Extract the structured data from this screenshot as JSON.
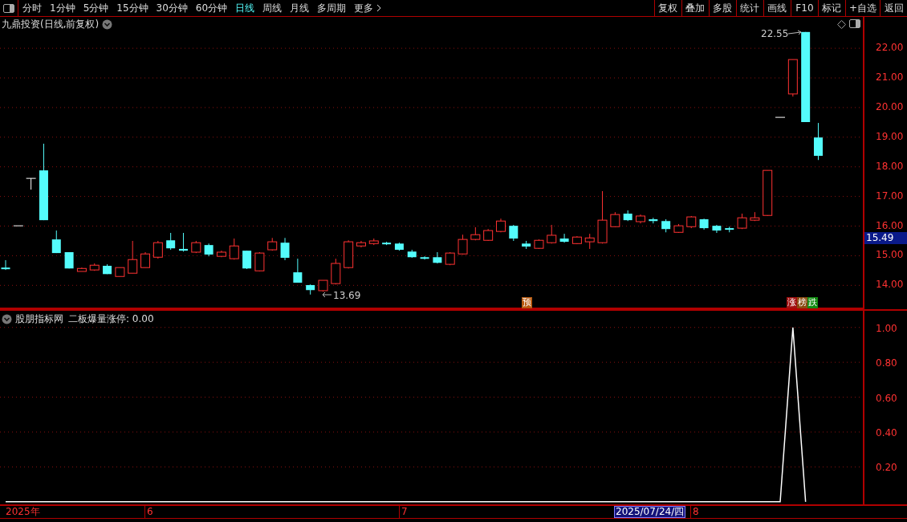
{
  "toolbar": {
    "periods": [
      {
        "label": "分时",
        "selected": false
      },
      {
        "label": "1分钟",
        "selected": false
      },
      {
        "label": "5分钟",
        "selected": false
      },
      {
        "label": "15分钟",
        "selected": false
      },
      {
        "label": "30分钟",
        "selected": false
      },
      {
        "label": "60分钟",
        "selected": false
      },
      {
        "label": "日线",
        "selected": true
      },
      {
        "label": "周线",
        "selected": false
      },
      {
        "label": "月线",
        "selected": false
      },
      {
        "label": "多周期",
        "selected": false
      },
      {
        "label": "更多",
        "selected": false
      }
    ],
    "actions": [
      "复权",
      "叠加",
      "多股",
      "统计",
      "画线",
      "F10",
      "标记",
      "+自选",
      "返回"
    ]
  },
  "main_pane": {
    "title": "九鼎投资(日线,前复权)",
    "high_label": "22.55",
    "low_label": "13.69",
    "current_price": "15.49",
    "markers": [
      {
        "text": "预",
        "color": "#b85a10"
      },
      {
        "text": "涨",
        "color": "#a01010"
      },
      {
        "text": "榜",
        "color": "#8a4a10"
      },
      {
        "text": "跌",
        "color": "#108a10"
      }
    ],
    "chart_data": {
      "type": "candlestick",
      "ylim": [
        13.25,
        23.06
      ],
      "grid": true,
      "yticks": [
        {
          "value": 22,
          "label": "22.00"
        },
        {
          "value": 21,
          "label": "21.00"
        },
        {
          "value": 20,
          "label": "20.00"
        },
        {
          "value": 19,
          "label": "19.00"
        },
        {
          "value": 18,
          "label": "18.00"
        },
        {
          "value": 17,
          "label": "17.00"
        },
        {
          "value": 16,
          "label": "16.00"
        },
        {
          "value": 15,
          "label": "15.00"
        },
        {
          "value": 14,
          "label": "14.00"
        }
      ],
      "ohlc": [
        [
          14.6,
          14.85,
          14.52,
          14.57
        ],
        [
          16.01,
          16.01,
          16.01,
          16.01
        ],
        [
          17.61,
          17.61,
          17.23,
          17.61
        ],
        [
          17.88,
          18.78,
          16.2,
          16.2
        ],
        [
          15.55,
          15.85,
          15.09,
          15.09
        ],
        [
          15.12,
          15.12,
          14.57,
          14.57
        ],
        [
          14.47,
          14.6,
          14.47,
          14.57
        ],
        [
          14.52,
          14.74,
          14.49,
          14.68
        ],
        [
          14.66,
          14.71,
          14.38,
          14.38
        ],
        [
          14.3,
          14.6,
          14.3,
          14.6
        ],
        [
          14.41,
          15.5,
          14.41,
          14.87
        ],
        [
          14.6,
          15.12,
          14.6,
          15.06
        ],
        [
          14.95,
          15.5,
          14.9,
          15.44
        ],
        [
          15.52,
          15.77,
          15.2,
          15.25
        ],
        [
          15.23,
          15.77,
          15.14,
          15.17
        ],
        [
          15.12,
          15.5,
          15.09,
          15.44
        ],
        [
          15.36,
          15.41,
          14.98,
          15.04
        ],
        [
          14.98,
          15.17,
          14.95,
          15.12
        ],
        [
          14.9,
          15.58,
          14.87,
          15.33
        ],
        [
          15.17,
          15.17,
          14.55,
          14.57
        ],
        [
          14.49,
          15.12,
          14.47,
          15.09
        ],
        [
          15.2,
          15.6,
          15.17,
          15.47
        ],
        [
          15.44,
          15.6,
          14.85,
          14.93
        ],
        [
          14.44,
          14.9,
          14.09,
          14.09
        ],
        [
          14.01,
          14.03,
          13.69,
          13.84
        ],
        [
          13.82,
          14.17,
          13.79,
          14.17
        ],
        [
          14.06,
          14.9,
          14.03,
          14.74
        ],
        [
          14.6,
          15.52,
          14.57,
          15.47
        ],
        [
          15.33,
          15.5,
          15.28,
          15.44
        ],
        [
          15.41,
          15.58,
          15.36,
          15.5
        ],
        [
          15.44,
          15.47,
          15.36,
          15.39
        ],
        [
          15.41,
          15.44,
          15.17,
          15.2
        ],
        [
          15.14,
          15.2,
          14.93,
          14.95
        ],
        [
          14.95,
          14.98,
          14.87,
          14.9
        ],
        [
          14.95,
          15.12,
          14.74,
          14.76
        ],
        [
          14.71,
          15.12,
          14.68,
          15.09
        ],
        [
          15.06,
          15.71,
          15.04,
          15.55
        ],
        [
          15.55,
          15.96,
          15.52,
          15.71
        ],
        [
          15.52,
          15.9,
          15.5,
          15.85
        ],
        [
          15.82,
          16.25,
          15.79,
          16.17
        ],
        [
          16.01,
          16.04,
          15.5,
          15.58
        ],
        [
          15.41,
          15.5,
          15.23,
          15.31
        ],
        [
          15.25,
          15.55,
          15.23,
          15.52
        ],
        [
          15.44,
          16.04,
          15.41,
          15.69
        ],
        [
          15.58,
          15.74,
          15.44,
          15.47
        ],
        [
          15.41,
          15.66,
          15.39,
          15.63
        ],
        [
          15.47,
          15.74,
          15.23,
          15.6
        ],
        [
          15.44,
          17.18,
          15.41,
          16.2
        ],
        [
          15.98,
          16.47,
          15.96,
          16.39
        ],
        [
          16.42,
          16.53,
          16.17,
          16.2
        ],
        [
          16.15,
          16.39,
          16.09,
          16.34
        ],
        [
          16.23,
          16.28,
          16.09,
          16.17
        ],
        [
          16.17,
          16.23,
          15.79,
          15.9
        ],
        [
          15.79,
          16.07,
          15.77,
          16.01
        ],
        [
          15.98,
          16.34,
          15.93,
          16.31
        ],
        [
          16.23,
          16.25,
          15.88,
          15.93
        ],
        [
          16.01,
          16.04,
          15.77,
          15.85
        ],
        [
          15.93,
          15.98,
          15.79,
          15.88
        ],
        [
          15.93,
          16.42,
          15.9,
          16.28
        ],
        [
          16.2,
          16.47,
          16.17,
          16.28
        ],
        [
          16.36,
          17.88,
          16.34,
          17.88
        ],
        [
          19.67,
          19.67,
          19.67,
          19.67
        ],
        [
          20.46,
          21.62,
          20.37,
          21.62
        ],
        [
          22.55,
          22.55,
          19.51,
          19.51
        ],
        [
          18.99,
          19.48,
          18.23,
          18.37
        ]
      ]
    }
  },
  "indicator_pane": {
    "source": "股朋指标网",
    "reading": ": 0.00",
    "chart_data": {
      "type": "line",
      "ylim": [
        -0.01,
        1.1
      ],
      "grid": true,
      "yticks": [
        {
          "value": 0.2,
          "label": "0.20"
        },
        {
          "value": 0.4,
          "label": "0.40"
        },
        {
          "value": 0.6,
          "label": "0.60"
        },
        {
          "value": 0.8,
          "label": "0.80"
        },
        {
          "value": 1,
          "label": "1.00"
        }
      ],
      "series": [
        {
          "name": "二板爆量涨停",
          "color": "#ffffff",
          "values": [
            0,
            0,
            0,
            0,
            0,
            0,
            0,
            0,
            0,
            0,
            0,
            0,
            0,
            0,
            0,
            0,
            0,
            0,
            0,
            0,
            0,
            0,
            0,
            0,
            0,
            0,
            0,
            0,
            0,
            0,
            0,
            0,
            0,
            0,
            0,
            0,
            0,
            0,
            0,
            0,
            0,
            0,
            0,
            0,
            0,
            0,
            0,
            0,
            0,
            0,
            0,
            0,
            0,
            0,
            0,
            0,
            0,
            0,
            0,
            0,
            0,
            0,
            1,
            0
          ]
        }
      ]
    }
  },
  "date_bar": {
    "labels": [
      "2025年",
      "6",
      "7",
      "8"
    ],
    "cursor_date": "2025/07/24/四"
  }
}
